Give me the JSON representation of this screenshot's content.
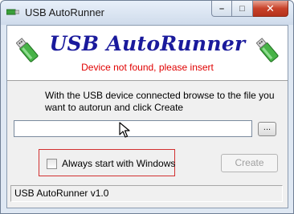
{
  "window": {
    "title": "USB AutoRunner",
    "min_glyph": "–",
    "max_glyph": "□",
    "close_glyph": "✕"
  },
  "header": {
    "heading": "USB AutoRunner",
    "status": "Device not found, please insert",
    "icon": "usb-drive-icon",
    "status_color": "#e00000"
  },
  "main": {
    "instructions": "With the USB device connected browse to the file you want to autorun and click Create",
    "path_value": "",
    "browse_label": "...",
    "always_start_label": "Always start with Windows",
    "always_start_checked": false,
    "create_label": "Create",
    "create_enabled": false
  },
  "statusbar": {
    "text": "USB AutoRunner v1.0"
  }
}
